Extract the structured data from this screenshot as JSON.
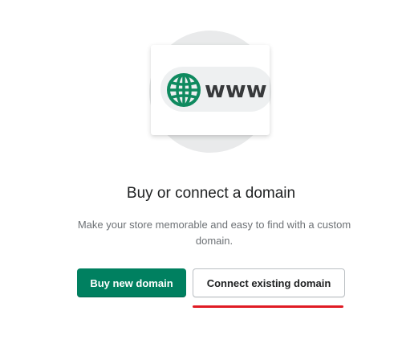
{
  "illustration": {
    "url_text": "www",
    "icon": "globe-icon",
    "icon_color": "#0f8a5f"
  },
  "empty_state": {
    "title": "Buy or connect a domain",
    "description": "Make your store memorable and easy to find with a custom domain."
  },
  "actions": {
    "buy_label": "Buy new domain",
    "connect_label": "Connect existing domain"
  },
  "colors": {
    "primary": "#008060",
    "highlight_underline": "#e01b24"
  }
}
